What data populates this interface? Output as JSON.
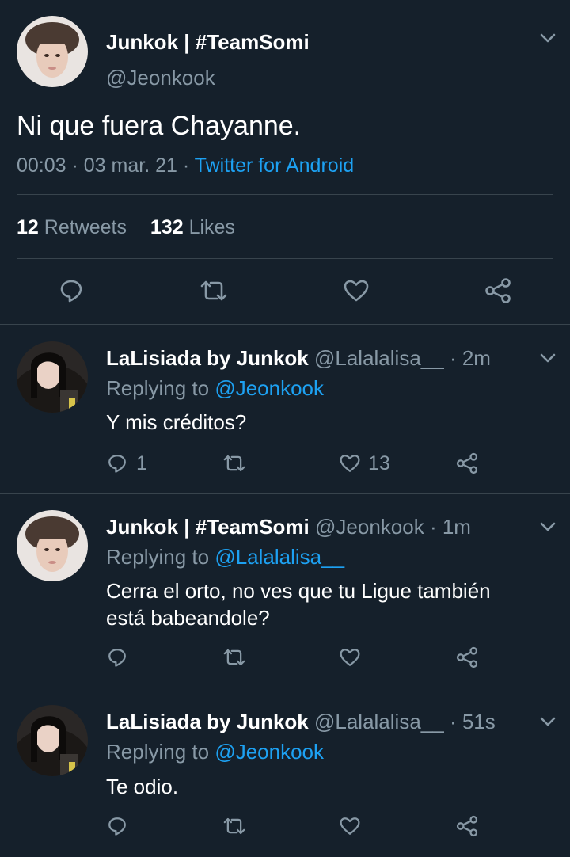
{
  "main_tweet": {
    "display_name": "Junkok | #TeamSomi",
    "handle": "@Jeonkook",
    "text": "Ni que fuera Chayanne.",
    "time": "00:03 · 03 mar. 21 · ",
    "source": "Twitter for Android",
    "retweets_count": "12",
    "retweets_label": "Retweets",
    "likes_count": "132",
    "likes_label": "Likes"
  },
  "replies": [
    {
      "display_name": "LaLisiada by Junkok",
      "handle": "@Lalalalisa__",
      "age": "· 2m",
      "replying_prefix": "Replying to",
      "replying_to": "@Jeonkook",
      "text_lines": [
        "Y mis créditos?"
      ],
      "reply_count": "1",
      "retweet_count": "",
      "like_count": "13"
    },
    {
      "display_name": "Junkok | #TeamSomi",
      "handle": "@Jeonkook",
      "age": "· 1m",
      "replying_prefix": "Replying to",
      "replying_to": "@Lalalalisa__",
      "text_lines": [
        "Cerra el orto, no ves que tu Ligue también",
        "está babeandole?"
      ],
      "reply_count": "",
      "retweet_count": "",
      "like_count": ""
    },
    {
      "display_name": "LaLisiada by Junkok",
      "handle": "@Lalalalisa__",
      "age": "· 51s",
      "replying_prefix": "Replying to",
      "replying_to": "@Jeonkook",
      "text_lines": [
        "Te odio."
      ],
      "reply_count": "",
      "retweet_count": "",
      "like_count": ""
    }
  ],
  "colors": {
    "background": "#15202b",
    "link": "#1da1f2",
    "muted": "#8899a6",
    "divider": "#38444d"
  },
  "icons": [
    "chevron-down-icon",
    "reply-icon",
    "retweet-icon",
    "like-icon",
    "share-icon"
  ]
}
